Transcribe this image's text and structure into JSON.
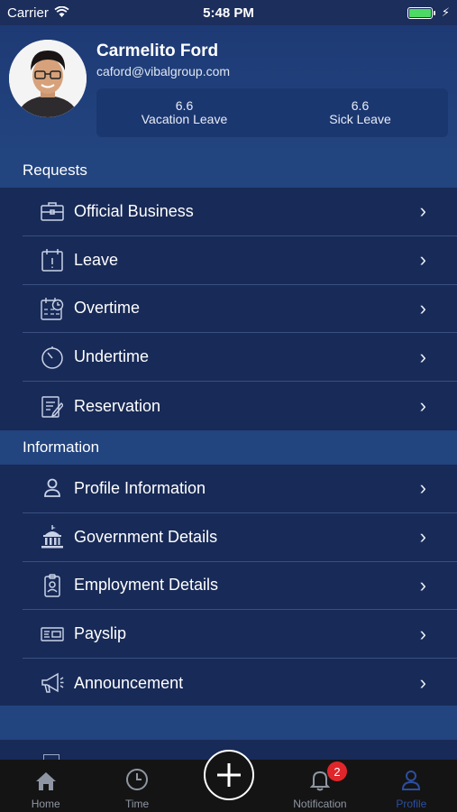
{
  "status_bar": {
    "carrier": "Carrier",
    "time": "5:48 PM"
  },
  "profile": {
    "name": "Carmelito Ford",
    "email": "caford@vibalgroup.com",
    "leave": [
      {
        "value": "6.6",
        "label": "Vacation Leave"
      },
      {
        "value": "6.6",
        "label": "Sick Leave"
      }
    ]
  },
  "sections": {
    "requests": {
      "title": "Requests",
      "items": [
        {
          "label": "Official Business",
          "icon": "briefcase-icon"
        },
        {
          "label": "Leave",
          "icon": "calendar-alert-icon"
        },
        {
          "label": "Overtime",
          "icon": "calendar-clock-icon"
        },
        {
          "label": "Undertime",
          "icon": "stopwatch-icon"
        },
        {
          "label": "Reservation",
          "icon": "clipboard-edit-icon"
        }
      ]
    },
    "information": {
      "title": "Information",
      "items": [
        {
          "label": "Profile Information",
          "icon": "person-icon"
        },
        {
          "label": "Government Details",
          "icon": "government-building-icon"
        },
        {
          "label": "Employment Details",
          "icon": "id-badge-icon"
        },
        {
          "label": "Payslip",
          "icon": "payslip-icon"
        },
        {
          "label": "Announcement",
          "icon": "megaphone-icon"
        }
      ]
    }
  },
  "tabbar": {
    "tabs": [
      {
        "label": "Home",
        "icon": "home-icon"
      },
      {
        "label": "Time",
        "icon": "clock-icon"
      },
      {
        "label": "",
        "icon": "plus-icon"
      },
      {
        "label": "Notification",
        "icon": "bell-icon"
      },
      {
        "label": "Profile",
        "icon": "profile-icon"
      }
    ],
    "notification_badge": "2",
    "active_tab": "Profile"
  },
  "colors": {
    "background": "#1c2e5c",
    "section_header": "#22447f",
    "list_bg": "#182a57",
    "active_tab": "#2c4ea0",
    "badge": "#e0262b",
    "battery": "#4cd964"
  }
}
